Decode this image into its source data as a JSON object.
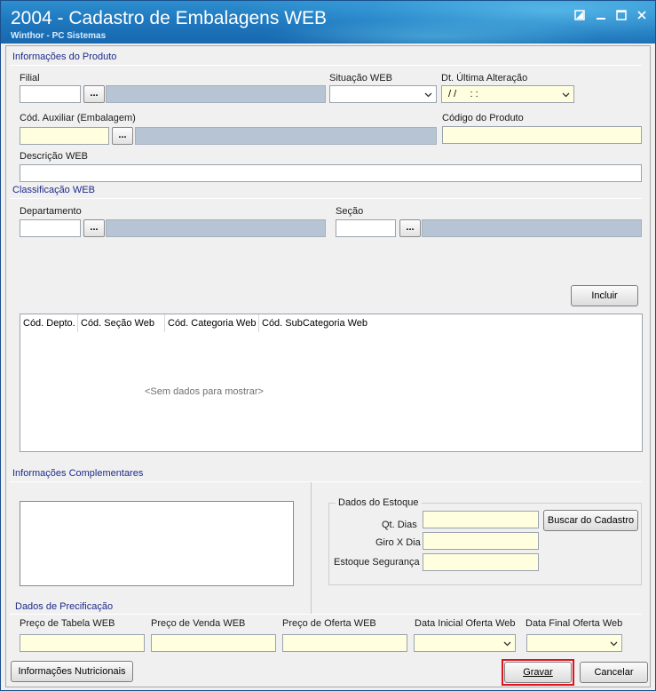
{
  "window": {
    "title": "2004 - Cadastro de Embalagens WEB",
    "subtitle": "Winthor - PC Sistemas",
    "controls": [
      "restore-icon",
      "minimize-icon",
      "maximize-icon",
      "close-icon"
    ]
  },
  "produto": {
    "section_title": "Informações do Produto",
    "filial_label": "Filial",
    "filial_value": "",
    "lookup_label": "...",
    "situacao_label": "Situação WEB",
    "situacao_value": "",
    "dt_alteracao_label": "Dt. Última Alteração",
    "dt_alteracao_value": " / /     : :",
    "cod_auxiliar_label": "Cód. Auxiliar (Embalagem)",
    "cod_auxiliar_value": "",
    "codigo_produto_label": "Código do Produto",
    "codigo_produto_value": "",
    "descricao_label": "Descrição WEB",
    "descricao_value": ""
  },
  "classificacao": {
    "section_title": "Classificação WEB",
    "departamento_label": "Departamento",
    "secao_label": "Seção",
    "incluir_label": "Incluir",
    "columns": [
      "Cód. Depto.",
      "Cód. Seção Web",
      "Cód. Categoria Web",
      "Cód. SubCategoria Web"
    ],
    "empty_text": "<Sem dados para mostrar>"
  },
  "complementares": {
    "section_title": "Informações Complementares",
    "estoque_title": "Dados do Estoque",
    "qt_dias_label": "Qt. Dias",
    "giro_label": "Giro X Dia",
    "estoque_seguranca_label": "Estoque Segurança",
    "buscar_label": "Buscar do Cadastro"
  },
  "precificacao": {
    "section_title": "Dados de Precificação",
    "preco_tabela_label": "Preço de Tabela WEB",
    "preco_venda_label": "Preço de Venda WEB",
    "preco_oferta_label": "Preço de Oferta WEB",
    "data_inicial_label": "Data Inicial Oferta Web",
    "data_final_label": "Data Final Oferta Web"
  },
  "footer": {
    "nutricionais_label": "Informações Nutricionais",
    "gravar_label": "Gravar",
    "cancelar_label": "Cancelar"
  },
  "colors": {
    "titlebar": "#1f78bf",
    "section_title": "#1d2a8a",
    "required_field": "#ffffe0",
    "readonly_field": "#b7c4d3",
    "focus_border": "#e0121f"
  }
}
